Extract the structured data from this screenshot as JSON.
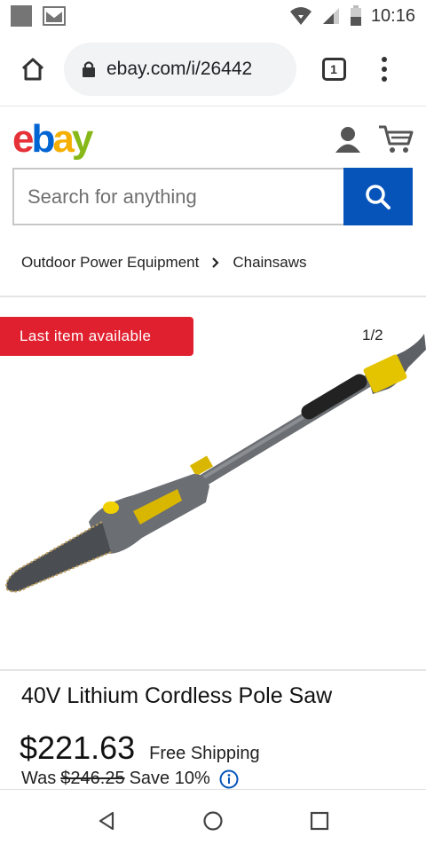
{
  "status_bar": {
    "time": "10:16"
  },
  "browser": {
    "url": "ebay.com/i/26442",
    "tab_count": "1"
  },
  "search": {
    "placeholder": "Search for anything"
  },
  "breadcrumb": {
    "items": [
      "Outdoor Power Equipment",
      "Chainsaws"
    ]
  },
  "image": {
    "badge": "Last item available",
    "counter": "1/2"
  },
  "product": {
    "title": "40V Lithium Cordless Pole Saw",
    "price": "$221.63",
    "shipping": "Free Shipping",
    "was_label": "Was",
    "was_price": "$246.25",
    "savings": "Save 10%"
  },
  "colors": {
    "ebay_red": "#e53238",
    "ebay_blue": "#0064d2",
    "ebay_yellow": "#f5af02",
    "ebay_green": "#86b817",
    "search_blue": "#0654ba",
    "badge_red": "#e0202f"
  }
}
